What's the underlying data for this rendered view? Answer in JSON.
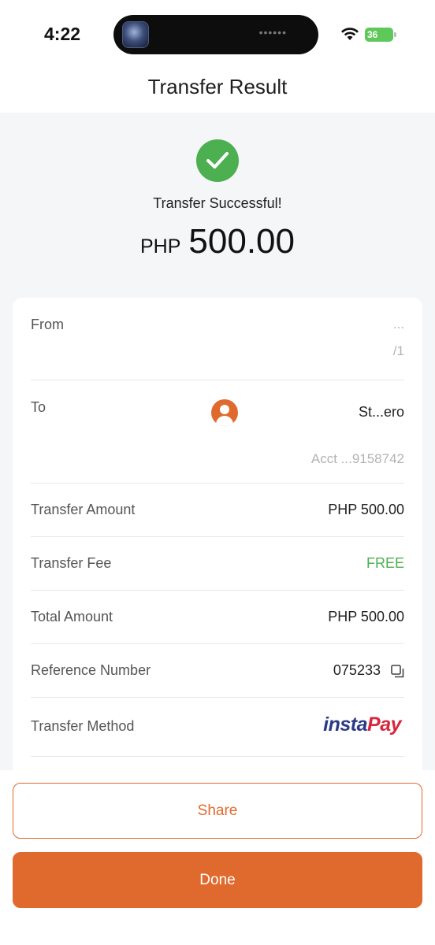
{
  "status_bar": {
    "time": "4:22",
    "battery": "36"
  },
  "header": {
    "title": "Transfer Result"
  },
  "result": {
    "message": "Transfer Successful!",
    "currency": "PHP",
    "amount": "500.00"
  },
  "details": {
    "from": {
      "label": "From",
      "line1": "...",
      "line2": "/1"
    },
    "to": {
      "label": "To",
      "name": "St...ero",
      "account": "Acct ...9158742"
    },
    "transfer_amount": {
      "label": "Transfer Amount",
      "value": "PHP 500.00"
    },
    "transfer_fee": {
      "label": "Transfer Fee",
      "value": "FREE"
    },
    "total_amount": {
      "label": "Total Amount",
      "value": "PHP 500.00"
    },
    "reference_number": {
      "label": "Reference Number",
      "value": "075233"
    },
    "transfer_method": {
      "label": "Transfer Method",
      "logo_insta": "insta",
      "logo_pay": "Pay"
    }
  },
  "actions": {
    "share_label": "Share",
    "done_label": "Done"
  },
  "colors": {
    "accent": "#e06a2e",
    "success": "#4caf50",
    "instapay_blue": "#2b3a86",
    "instapay_red": "#d7263d"
  },
  "icons": {
    "success": "check-circle-icon",
    "avatar": "user-icon",
    "copy": "copy-icon",
    "wifi": "wifi-icon",
    "battery": "battery-icon"
  }
}
